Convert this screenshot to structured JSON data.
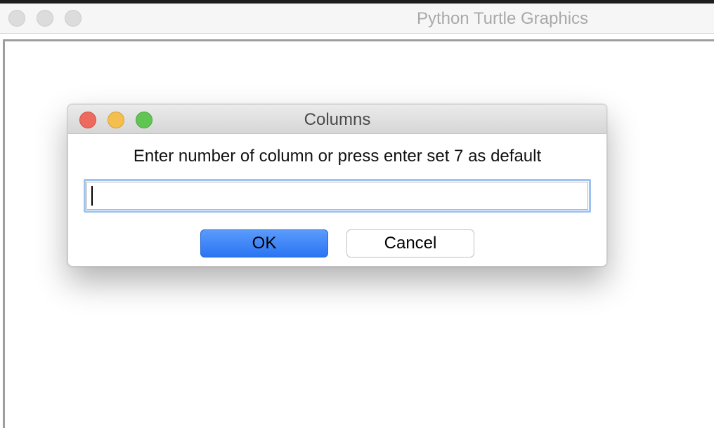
{
  "main_window": {
    "title": "Python Turtle Graphics"
  },
  "dialog": {
    "title": "Columns",
    "prompt": "Enter number of column or press enter set 7 as default",
    "input": {
      "value": "",
      "placeholder": ""
    },
    "buttons": {
      "ok_label": "OK",
      "cancel_label": "Cancel"
    }
  },
  "icons": {
    "close": "close-traffic-light",
    "minimize": "minimize-traffic-light",
    "maximize": "maximize-traffic-light"
  },
  "colors": {
    "close": "#ed6a5e",
    "minimize": "#f5bf4f",
    "maximize": "#61c554",
    "ok_button": "#2a75f3",
    "focus_ring": "#9cc3f2"
  }
}
